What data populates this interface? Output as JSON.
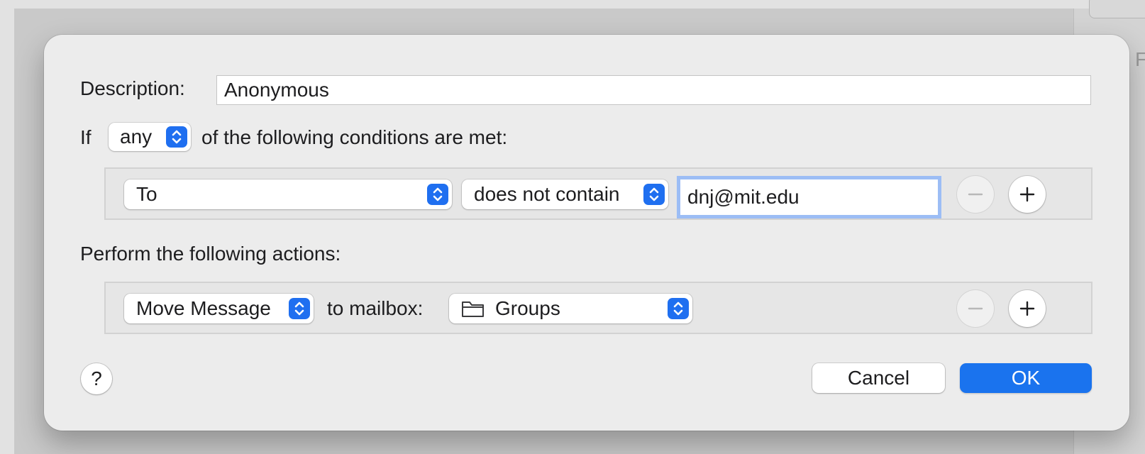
{
  "dialog": {
    "description_label": "Description:",
    "description_value": "Anonymous",
    "if_label": "If",
    "match_selected": "any",
    "conditions_suffix": "of the following conditions are met:",
    "condition": {
      "field_selected": "To",
      "operator_selected": "does not contain",
      "value": "dnj@mit.edu",
      "remove_icon": "minus-icon",
      "add_icon": "plus-icon"
    },
    "actions_label": "Perform the following actions:",
    "action": {
      "action_selected": "Move Message",
      "mailbox_label": "to mailbox:",
      "mailbox_icon": "folder-icon",
      "mailbox_selected": "Groups",
      "remove_icon": "minus-icon",
      "add_icon": "plus-icon"
    },
    "help_label": "?",
    "cancel_label": "Cancel",
    "ok_label": "OK"
  },
  "colors": {
    "accent": "#1a73ee",
    "focus_ring": "#9cbdf5",
    "dialog_bg": "#ececec"
  }
}
